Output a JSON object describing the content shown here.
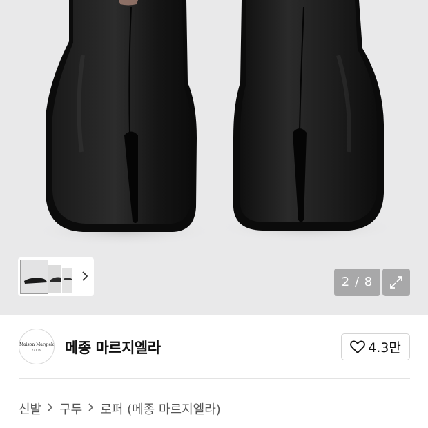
{
  "gallery": {
    "current_index": "2",
    "separator": "/",
    "total": "8",
    "counter_text": "2 / 8",
    "thumbnail_next_icon": "chevron-right-icon",
    "expand_icon": "expand-arrows-icon",
    "background_color": "#e9e9ea"
  },
  "brand": {
    "logo_text": "Maison Margiela",
    "logo_subtext": "PARIS",
    "name": "메종 마르지엘라",
    "like_icon": "heart-outline-icon",
    "like_count": "4.3만"
  },
  "breadcrumb": {
    "separator_icon": "chevron-right-icon",
    "items": [
      {
        "label": "신발"
      },
      {
        "label": "구두"
      },
      {
        "label": "로퍼 (메종 마르지엘라)"
      }
    ]
  }
}
